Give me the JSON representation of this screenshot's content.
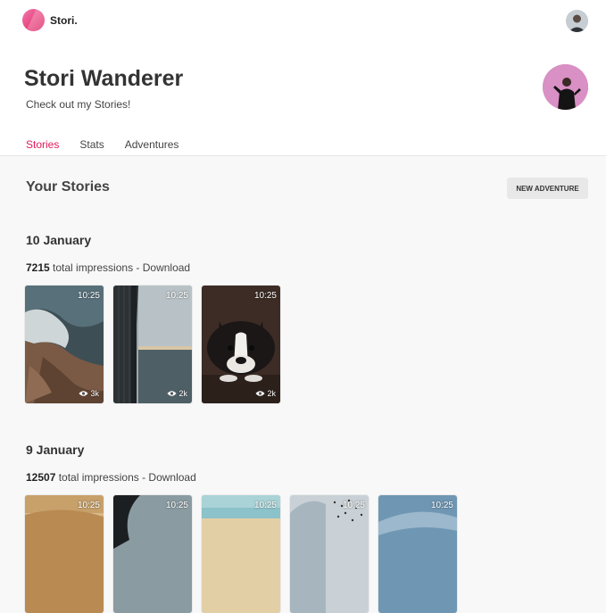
{
  "app": {
    "brand": "Stori."
  },
  "profile": {
    "name": "Stori Wanderer",
    "tagline": "Check out my Stories!"
  },
  "tabs": [
    {
      "label": "Stories",
      "active": true
    },
    {
      "label": "Stats",
      "active": false
    },
    {
      "label": "Adventures",
      "active": false
    }
  ],
  "section": {
    "title": "Your Stories",
    "new_button": "NEW ADVENTURE"
  },
  "groups": [
    {
      "date": "10 January",
      "impressions_count": "7215",
      "impressions_text": " total impressions - Download",
      "stories": [
        {
          "time": "10:25",
          "views": "3k",
          "image": "coastal-rocks"
        },
        {
          "time": "10:25",
          "views": "2k",
          "image": "building-sea-view"
        },
        {
          "time": "10:25",
          "views": "2k",
          "image": "boston-terrier"
        }
      ]
    },
    {
      "date": "9 January",
      "impressions_count": "12507",
      "impressions_text": " total impressions - Download",
      "stories": [
        {
          "time": "10:25",
          "image": "desert-dunes"
        },
        {
          "time": "10:25",
          "image": "dark-curve"
        },
        {
          "time": "10:25",
          "image": "beach-shore"
        },
        {
          "time": "10:25",
          "image": "snow-crowd"
        },
        {
          "time": "10:25",
          "image": "blue-sky"
        }
      ]
    }
  ],
  "colors": {
    "accent": "#e01a5a",
    "background": "#f8f8f8"
  }
}
